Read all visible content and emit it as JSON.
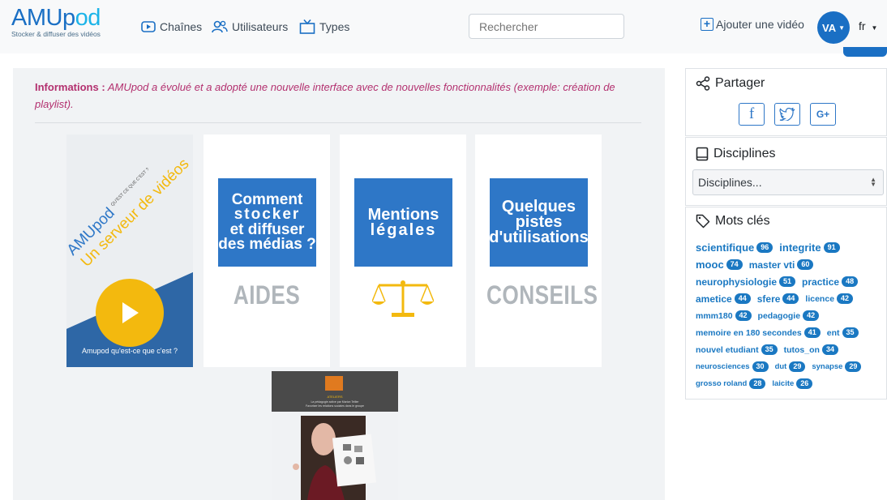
{
  "header": {
    "logo": {
      "part1": "AMUp",
      "part2": "od"
    },
    "tagline": "Stocker & diffuser des vidéos",
    "nav": [
      {
        "label": "Chaînes",
        "icon": "play-square-icon"
      },
      {
        "label": "Utilisateurs",
        "icon": "users-icon"
      },
      {
        "label": "Types",
        "icon": "tv-icon"
      }
    ],
    "search_placeholder": "Rechercher",
    "add_video_label": "Ajouter une vidéo",
    "user_initials": "VA",
    "language": "fr"
  },
  "main": {
    "info_label": "Informations :",
    "info_text": "AMUpod a évolué et a adopté une nouvelle interface avec de nouvelles fonctionnalités (exemple: création de playlist).",
    "featured_video": {
      "brand": "AMUpod",
      "question": "QU'EST CE QUE C'EST ?",
      "headline": "Un serveur de vidéos",
      "caption": "Amupod qu'est-ce que c'est ?"
    },
    "cards": [
      {
        "box_lines": [
          "Comment",
          "stocker",
          "et diffuser",
          "des médias ?"
        ],
        "big": "AIDES"
      },
      {
        "box_lines": [
          "Mentions",
          "légales"
        ],
        "big": ""
      },
      {
        "box_lines": [
          "Quelques",
          "pistes",
          "d'utilisations"
        ],
        "big": "CONSEILS"
      }
    ],
    "lower_video": {
      "lines": [
        "ATELIERS",
        "La pédagogie active par Marion Tellier",
        "Favoriser les relations sociales dans le groupe"
      ]
    }
  },
  "sidebar": {
    "share_title": "Partager",
    "share_buttons": [
      "facebook-icon",
      "twitter-icon",
      "G+"
    ],
    "disciplines_title": "Disciplines",
    "disciplines_select": "Disciplines...",
    "keywords_title": "Mots clés",
    "keyword_lines": [
      [
        {
          "name": "scientifique",
          "count": "96"
        },
        {
          "name": "integrite",
          "count": "91"
        }
      ],
      [
        {
          "name": "mooc",
          "count": "74"
        },
        {
          "name": "master vti",
          "count": "60"
        }
      ],
      [
        {
          "name": "neurophysiologie",
          "count": "51"
        },
        {
          "name": "practice",
          "count": "48"
        }
      ],
      [
        {
          "name": "ametice",
          "count": "44"
        },
        {
          "name": "sfere",
          "count": "44"
        },
        {
          "name": "licence",
          "count": "42"
        }
      ],
      [
        {
          "name": "mmm180",
          "count": "42"
        },
        {
          "name": "pedagogie",
          "count": "42"
        }
      ],
      [
        {
          "name": "memoire en 180 secondes",
          "count": "41"
        },
        {
          "name": "ent",
          "count": "35"
        }
      ],
      [
        {
          "name": "nouvel etudiant",
          "count": "35"
        },
        {
          "name": "tutos_on",
          "count": "34"
        }
      ],
      [
        {
          "name": "neurosciences",
          "count": "30"
        },
        {
          "name": "dut",
          "count": "29"
        },
        {
          "name": "synapse",
          "count": "29"
        }
      ],
      [
        {
          "name": "grosso roland",
          "count": "28"
        },
        {
          "name": "laicite",
          "count": "26"
        }
      ]
    ],
    "colors": {
      "accent": "#1a78c2",
      "info": "#b3306f",
      "brand_blue": "#2e77c7",
      "yellow": "#f3b90e"
    }
  }
}
